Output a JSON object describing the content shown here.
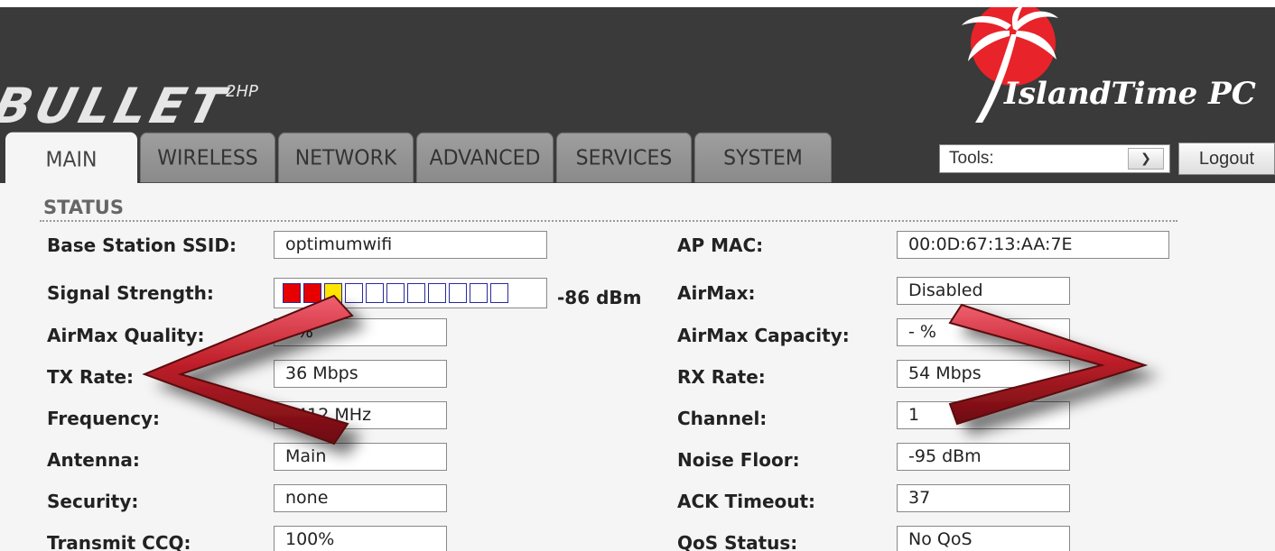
{
  "header": {
    "brand": "BULLET",
    "model": "2HP",
    "logo_text": "IslandTime PC"
  },
  "tabs": [
    "MAIN",
    "WIRELESS",
    "NETWORK",
    "ADVANCED",
    "SERVICES",
    "SYSTEM"
  ],
  "active_tab": "MAIN",
  "tools": {
    "label": "Tools:"
  },
  "logout_label": "Logout",
  "status_title": "STATUS",
  "left": {
    "ssid": {
      "label": "Base Station SSID:",
      "value": "optimumwifi"
    },
    "signal": {
      "label": "Signal Strength:",
      "dbm": "-86 dBm",
      "segments": [
        "red",
        "red",
        "yellow",
        "empty",
        "empty",
        "empty",
        "empty",
        "empty",
        "empty",
        "empty",
        "empty"
      ]
    },
    "airmax_quality": {
      "label": "AirMax Quality:",
      "value": "- %"
    },
    "tx_rate": {
      "label": "TX Rate:",
      "value": "36 Mbps"
    },
    "frequency": {
      "label": "Frequency:",
      "value": "2412 MHz"
    },
    "antenna": {
      "label": "Antenna:",
      "value": "Main"
    },
    "security": {
      "label": "Security:",
      "value": "none"
    },
    "transmit_ccq": {
      "label": "Transmit CCQ:",
      "value": "100%"
    }
  },
  "right": {
    "ap_mac": {
      "label": "AP MAC:",
      "value": "00:0D:67:13:AA:7E"
    },
    "airmax": {
      "label": "AirMax:",
      "value": "Disabled"
    },
    "airmax_capacity": {
      "label": "AirMax Capacity:",
      "value": "- %"
    },
    "rx_rate": {
      "label": "RX Rate:",
      "value": "54 Mbps"
    },
    "channel": {
      "label": "Channel:",
      "value": "1"
    },
    "noise_floor": {
      "label": "Noise Floor:",
      "value": "-95 dBm"
    },
    "ack_timeout": {
      "label": "ACK Timeout:",
      "value": "37"
    },
    "qos_status": {
      "label": "QoS Status:",
      "value": "No QoS"
    }
  },
  "colors": {
    "header_bg": "#3a3a3a",
    "page_bg": "#f5f5f5",
    "arrow": "#c0202a",
    "logo_circle": "#e8232a"
  }
}
